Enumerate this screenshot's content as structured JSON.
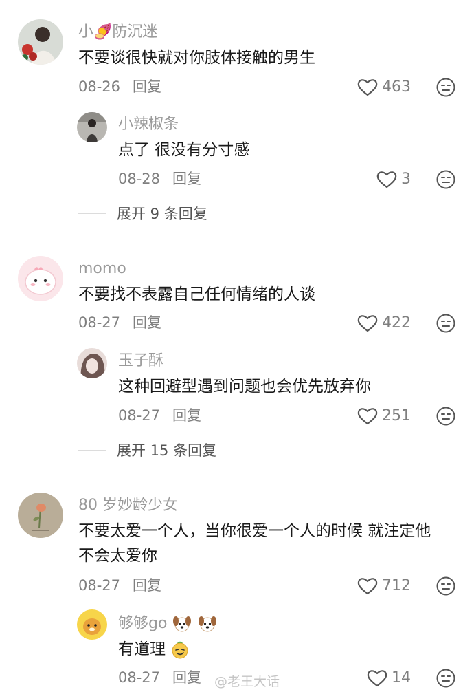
{
  "comments": [
    {
      "name": "小🍠防沉迷",
      "text": "不要谈很快就对你肢体接触的男生",
      "date": "08-26",
      "reply": "回复",
      "likes": "463",
      "replies": [
        {
          "name": "小辣椒条",
          "text": "点了 很没有分寸感",
          "date": "08-28",
          "reply": "回复",
          "likes": "3"
        }
      ],
      "expand": "展开 9 条回复"
    },
    {
      "name": "momo",
      "text": "不要找不表露自己任何情绪的人谈",
      "date": "08-27",
      "reply": "回复",
      "likes": "422",
      "replies": [
        {
          "name": "玉子酥",
          "text": "这种回避型遇到问题也会优先放弃你",
          "date": "08-27",
          "reply": "回复",
          "likes": "251"
        }
      ],
      "expand": "展开 15 条回复"
    },
    {
      "name": "80 岁妙龄少女",
      "text_line1": "不要太爱一个人，当你很爱一个人的时候 就注定他",
      "text_line2": "不会太爱你",
      "date": "08-27",
      "reply": "回复",
      "likes": "712",
      "replies": [
        {
          "name": "够够go",
          "text": "有道理",
          "date": "08-27",
          "reply": "回复",
          "likes": "14"
        }
      ]
    }
  ],
  "watermark": "@老王大话",
  "icons": {
    "like": "heart-outline-icon",
    "dislike": "neutral-face-icon",
    "avatar": "user-avatar"
  }
}
